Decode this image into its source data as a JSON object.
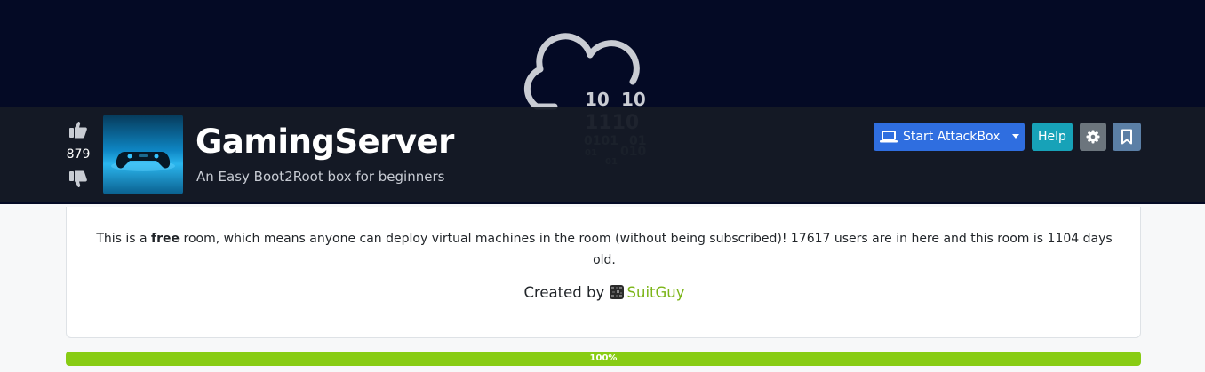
{
  "room": {
    "title": "GamingServer",
    "description": "An Easy Boot2Root box for beginners",
    "votes": "879",
    "binary_art": [
      "10",
      "10",
      "1110",
      "0101",
      "01",
      "01",
      "010",
      "01"
    ]
  },
  "actions": {
    "start_attackbox_label": "Start AttackBox",
    "help_label": "Help"
  },
  "info": {
    "text_before": "This is a ",
    "free_word": "free",
    "text_after": " room, which means anyone can deploy virtual machines in the room (without being subscribed)! 17617 users are in here and this room is 1104 days old.",
    "created_by_label": "Created by",
    "creator_name": "SuitGuy"
  },
  "progress": {
    "percent": 100,
    "label": "100%"
  },
  "colors": {
    "hero_bg": "#040a25",
    "room_bar_bg": "#161b26",
    "attackbox_button": "#2f6ee0",
    "help_button": "#17a2b8",
    "settings_button": "#6c757d",
    "bookmark_button": "#5b7fa6",
    "progress_fill": "#88cc14",
    "creator_link": "#7cb518"
  },
  "icons": {
    "upvote": "thumbs-up-icon",
    "downvote": "thumbs-down-icon",
    "attackbox": "laptop-icon",
    "settings": "gear-icon",
    "bookmark": "bookmark-icon",
    "dropdown": "caret-down-icon"
  }
}
